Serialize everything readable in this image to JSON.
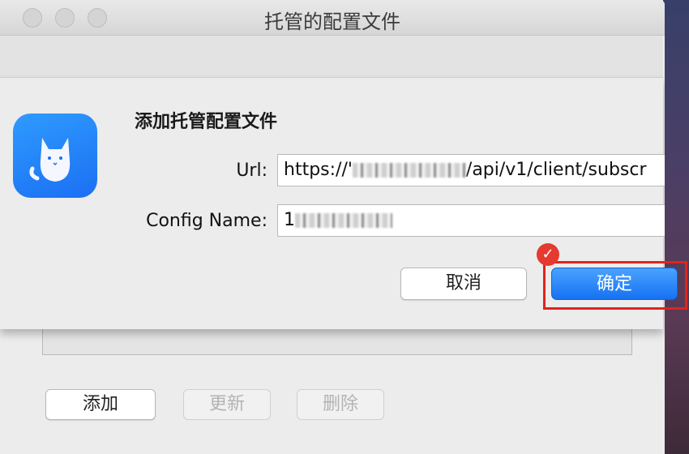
{
  "window": {
    "title": "托管的配置文件"
  },
  "main": {
    "buttons": {
      "add": "添加",
      "update": "更新",
      "delete": "删除"
    }
  },
  "sheet": {
    "heading": "添加托管配置文件",
    "url_label": "Url:",
    "url_value_prefix": "https://'",
    "url_value_suffix": "/api/v1/client/subscr",
    "config_name_label": "Config Name:",
    "config_name_value_prefix": "1",
    "cancel_label": "取消",
    "confirm_label": "确定"
  },
  "annotation": {
    "check_icon": "check-icon",
    "highlight_color": "#e0241b"
  },
  "colors": {
    "primary": "#1572f2",
    "app_icon": "#2f9bff"
  }
}
